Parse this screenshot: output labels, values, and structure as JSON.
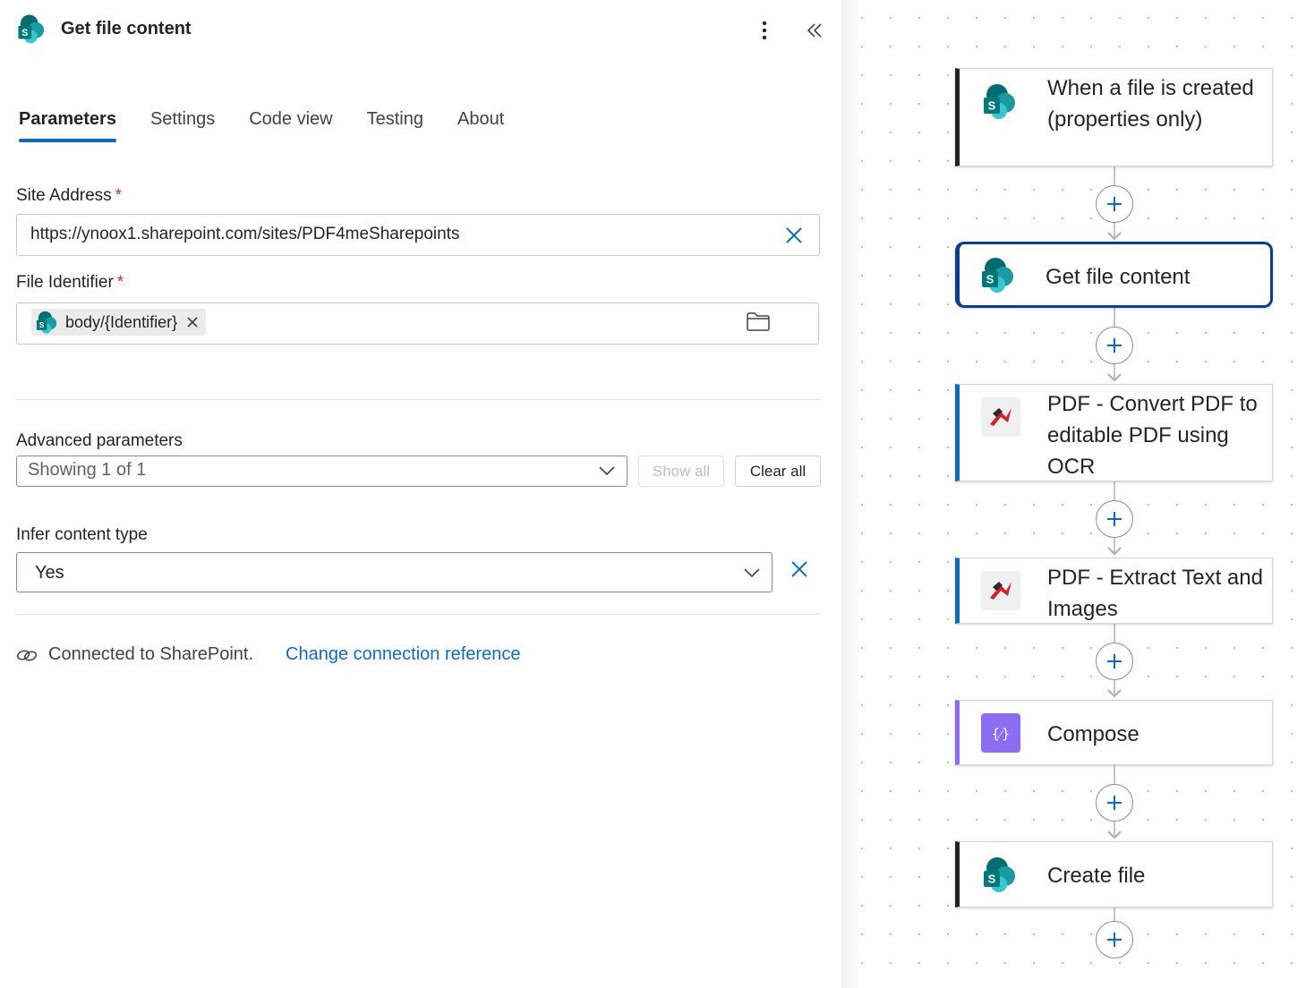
{
  "panel": {
    "title": "Get file content",
    "tabs": [
      "Parameters",
      "Settings",
      "Code view",
      "Testing",
      "About"
    ],
    "site_address": {
      "label": "Site Address",
      "required": "*",
      "value": "https://ynoox1.sharepoint.com/sites/PDF4meSharepoints"
    },
    "file_identifier": {
      "label": "File Identifier",
      "required": "*",
      "token": "body/{Identifier}"
    },
    "advanced": {
      "label": "Advanced parameters",
      "selected": "Showing 1 of 1",
      "show_all": "Show all",
      "clear_all": "Clear all"
    },
    "infer": {
      "label": "Infer content type",
      "selected": "Yes"
    },
    "connection": {
      "text": "Connected to SharePoint.",
      "link": "Change connection reference"
    }
  },
  "flow": {
    "steps": [
      {
        "title": "When a file is created (properties only)",
        "icon": "sharepoint-icon"
      },
      {
        "title": "Get file content",
        "icon": "sharepoint-icon"
      },
      {
        "title": "PDF - Convert PDF to editable PDF using OCR",
        "icon": "pdf4me-icon"
      },
      {
        "title": "PDF - Extract Text and Images",
        "icon": "pdf4me-icon"
      },
      {
        "title": "Compose",
        "icon": "compose-icon"
      },
      {
        "title": "Create file",
        "icon": "sharepoint-icon"
      }
    ]
  },
  "colors": {
    "accent": "#0f6cbd",
    "selected": "#0f3c8f",
    "compose": "#8c6cf0",
    "required": "#c4314b"
  }
}
